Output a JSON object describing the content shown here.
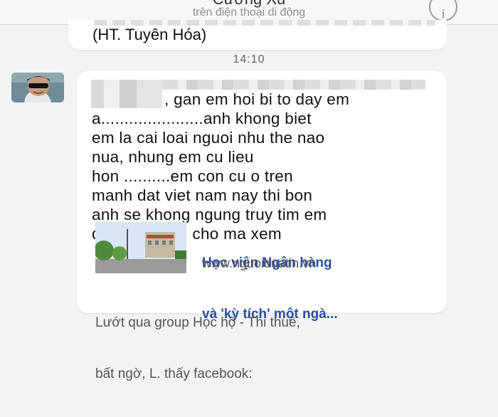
{
  "header": {
    "contact_name": "Cường Xu",
    "subtitle": "trên điện thoại di động",
    "info_icon": "info-icon",
    "info_glyph": "i"
  },
  "previous_message": {
    "text": "(HT. Tuyên Hóa)"
  },
  "timestamp": "14:10",
  "message": {
    "lines": [
      ", gan em hoi bi to day em",
      "a......................anh khong biet",
      "em la cai loai nguoi nhu the nao",
      "nua, nhung em cu lieu",
      "hon ..........em con cu o tren",
      "manh dat viet nam nay thi bon",
      "anh se khong ngung truy tim em",
      "dau ..........cu cho ma xem"
    ]
  },
  "link_preview": {
    "title_line1": "Học viện Ngân hàng",
    "title_line2": "và 'kỳ tích' một ngà...",
    "domain": "www.nguoiduatin.vn",
    "description_line1": "Lướt qua group Học hộ - Thi thuê,",
    "description_line2": "bất ngờ, L. thấy facebook:"
  },
  "colors": {
    "link_title": "#2a4fa0",
    "bubble_bg": "#ffffff",
    "background": "#f3f3f5"
  }
}
